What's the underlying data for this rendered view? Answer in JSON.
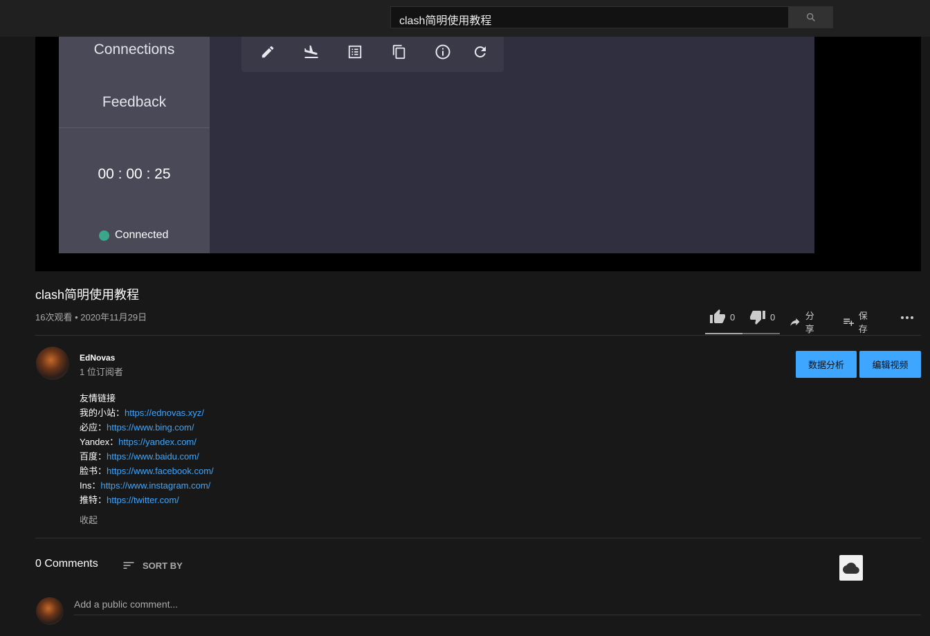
{
  "search": {
    "value": "clash简明使用教程"
  },
  "player_app": {
    "sidebar": {
      "connections": "Connections",
      "feedback": "Feedback",
      "timer": "00 : 00 : 25",
      "status": "Connected",
      "status_color": "#3aa78a"
    },
    "toolbar_icons": [
      "pencil-icon",
      "landing-icon",
      "list-icon",
      "copy-icon",
      "info-icon",
      "refresh-icon"
    ]
  },
  "video": {
    "title": "clash简明使用教程",
    "meta": "16次观看 • 2020年11月29日",
    "likes": "0",
    "dislikes": "0",
    "like_ratio": 0.5,
    "share_label": "分享",
    "save_label": "保存"
  },
  "channel": {
    "name": "EdNovas",
    "subscribers": "1 位订阅者",
    "analytics_button": "数据分析",
    "edit_button": "编辑视频",
    "accent": "#3ea6ff"
  },
  "description": {
    "heading": "友情链接",
    "links": [
      {
        "label": "我的小站：",
        "url": "https://ednovas.xyz/"
      },
      {
        "label": "必应：",
        "url": "https://www.bing.com/"
      },
      {
        "label": "Yandex：",
        "url": "https://yandex.com/"
      },
      {
        "label": "百度：",
        "url": "https://www.baidu.com/"
      },
      {
        "label": "脸书：",
        "url": "https://www.facebook.com/"
      },
      {
        "label": "Ins：",
        "url": "https://www.instagram.com/"
      },
      {
        "label": "推特：",
        "url": "https://twitter.com/"
      }
    ],
    "collapse": "收起"
  },
  "comments": {
    "count": "0 Comments",
    "sort_label": "SORT BY",
    "placeholder": "Add a public comment..."
  }
}
